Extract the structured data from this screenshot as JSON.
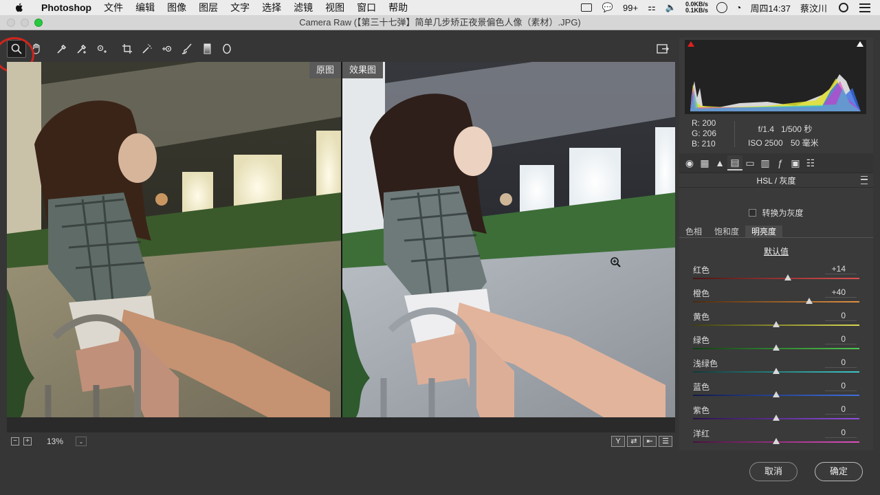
{
  "menubar": {
    "app_name": "Photoshop",
    "items": [
      "文件",
      "编辑",
      "图像",
      "图层",
      "文字",
      "选择",
      "滤镜",
      "视图",
      "窗口",
      "帮助"
    ],
    "status": {
      "badge": "99+",
      "net_up": "0.0KB/s",
      "net_down": "0.1KB/s",
      "clock": "周四14:37",
      "user": "蔡汶川"
    }
  },
  "window": {
    "title": "Camera Raw (【第三十七弹】简单几步矫正夜景偏色人像（素材）.JPG)"
  },
  "viewport": {
    "left_label": "原图",
    "right_label": "效果图"
  },
  "statusbar": {
    "zoom": "13%",
    "minus": "−",
    "plus": "+",
    "dropdown": "⌄"
  },
  "info": {
    "r": "R:  200",
    "g": "G:  206",
    "b": "B:  210",
    "aperture": "f/1.4",
    "shutter": "1/500 秒",
    "iso": "ISO 2500",
    "focal": "50 毫米"
  },
  "panel": {
    "section_title": "HSL / 灰度",
    "convert_gray": "转换为灰度",
    "subtabs": [
      "色相",
      "饱和度",
      "明亮度"
    ],
    "active_subtab": 2,
    "default_link": "默认值",
    "sliders": [
      {
        "label": "红色",
        "value": "+14",
        "pos": 14,
        "c1": "#4a1414",
        "c2": "#e05050"
      },
      {
        "label": "橙色",
        "value": "+40",
        "pos": 40,
        "c1": "#4a2a10",
        "c2": "#e09040"
      },
      {
        "label": "黄色",
        "value": "0",
        "pos": 0,
        "c1": "#3e3e10",
        "c2": "#dada50"
      },
      {
        "label": "绿色",
        "value": "0",
        "pos": 0,
        "c1": "#123e12",
        "c2": "#50c850"
      },
      {
        "label": "浅绿色",
        "value": "0",
        "pos": 0,
        "c1": "#103a3a",
        "c2": "#40c8c8"
      },
      {
        "label": "蓝色",
        "value": "0",
        "pos": 0,
        "c1": "#101a4a",
        "c2": "#4070e0"
      },
      {
        "label": "紫色",
        "value": "0",
        "pos": 0,
        "c1": "#2a104a",
        "c2": "#9050e0"
      },
      {
        "label": "洋红",
        "value": "0",
        "pos": 0,
        "c1": "#4a1040",
        "c2": "#e050c0"
      }
    ]
  },
  "buttons": {
    "cancel": "取消",
    "ok": "确定"
  }
}
